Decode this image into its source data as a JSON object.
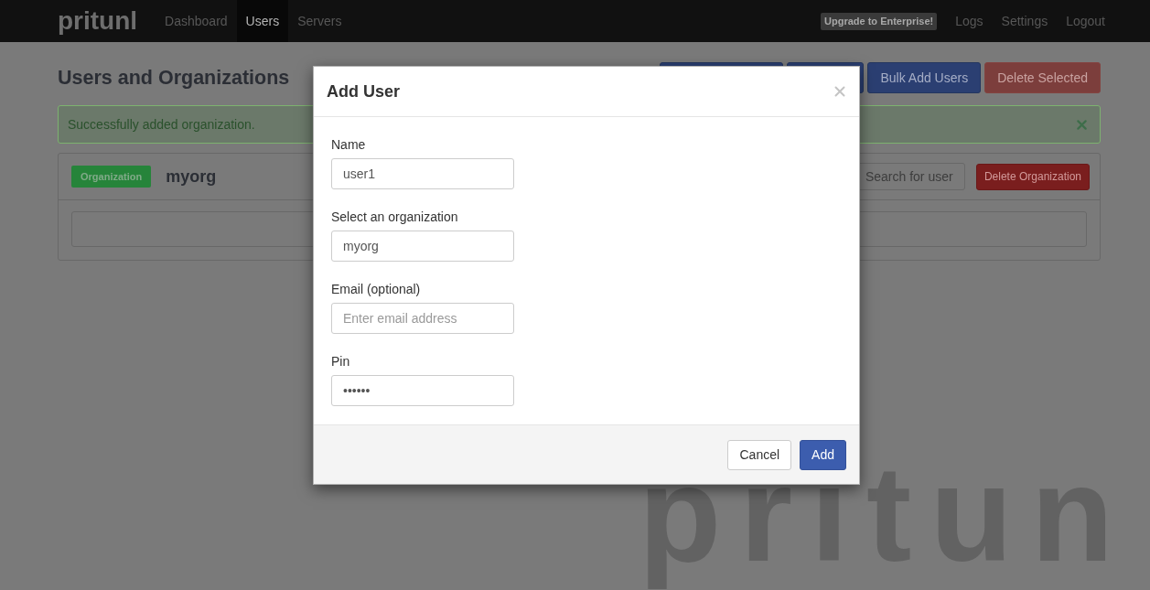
{
  "navbar": {
    "logo": "pritunl",
    "links": [
      {
        "label": "Dashboard",
        "selected": false
      },
      {
        "label": "Users",
        "selected": true
      },
      {
        "label": "Servers",
        "selected": false
      }
    ],
    "badge": "Upgrade to Enterprise!",
    "right_links": [
      "Logs",
      "Settings",
      "Logout"
    ]
  },
  "page": {
    "title": "Users and Organizations",
    "toolbar": [
      {
        "kind": "primary"
      },
      {
        "kind": "primary"
      },
      {
        "label": "Bulk Add Users",
        "kind": "primary"
      },
      {
        "label": "Delete Selected",
        "kind": "danger"
      }
    ]
  },
  "alert": {
    "message": "Successfully added organization."
  },
  "organization": {
    "badge": "Organization",
    "name": "myorg",
    "search": {
      "placeholder": "Search for user"
    },
    "delete_button": "Delete Organization"
  },
  "background_logo": "pritun",
  "modal": {
    "title": "Add User",
    "fields": [
      {
        "label": "Name",
        "value": "user1"
      },
      {
        "label": "Select an organization",
        "value": "myorg"
      },
      {
        "label": "Email (optional)",
        "placeholder": "Enter email address"
      },
      {
        "label": "Pin",
        "value": "••••••"
      }
    ],
    "buttons": [
      {
        "label": "Cancel",
        "kind": "default"
      },
      {
        "label": "Add",
        "kind": "primary"
      }
    ]
  }
}
